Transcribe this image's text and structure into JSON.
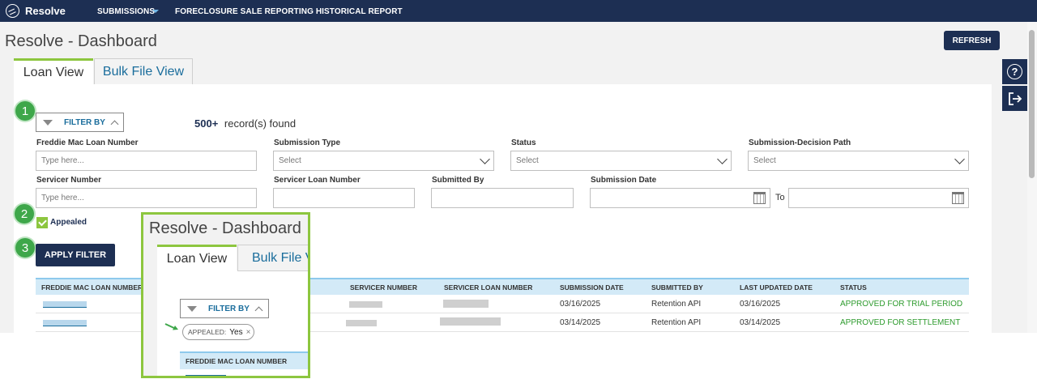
{
  "topbar": {
    "brand": "Resolve",
    "nav": [
      "SUBMISSIONS",
      "FORECLOSURE SALE REPORTING HISTORICAL REPORT"
    ]
  },
  "page": {
    "title": "Resolve - Dashboard",
    "refresh_label": "REFRESH"
  },
  "tabs": [
    "Loan View",
    "Bulk File View"
  ],
  "markers": [
    "1",
    "2",
    "3"
  ],
  "filter": {
    "toggle_label": "FILTER BY",
    "records_count": "500+",
    "records_label": "record(s) found",
    "fields": {
      "loan_number": {
        "label": "Freddie Mac Loan Number",
        "placeholder": "Type here..."
      },
      "submission_type": {
        "label": "Submission Type",
        "value": "Select"
      },
      "status": {
        "label": "Status",
        "value": "Select"
      },
      "decision_path": {
        "label": "Submission-Decision Path",
        "value": "Select"
      },
      "servicer_number": {
        "label": "Servicer Number",
        "placeholder": "Type here..."
      },
      "servicer_loan_number": {
        "label": "Servicer Loan Number"
      },
      "submitted_by": {
        "label": "Submitted By"
      },
      "submission_date": {
        "label": "Submission Date",
        "to_label": "To"
      }
    },
    "appealed_label": "Appealed",
    "appealed_checked": true,
    "apply_label": "APPLY FILTER"
  },
  "table": {
    "headers": [
      "FREDDIE MAC LOAN NUMBER",
      "SERVICER NUMBER",
      "SERVICER LOAN NUMBER",
      "SUBMISSION DATE",
      "SUBMITTED BY",
      "LAST UPDATED DATE",
      "STATUS"
    ],
    "rows": [
      {
        "submission_date": "03/16/2025",
        "submitted_by": "Retention API",
        "last_updated": "03/16/2025",
        "status": "APPROVED FOR TRIAL PERIOD"
      },
      {
        "submission_date": "03/14/2025",
        "submitted_by": "Retention API",
        "last_updated": "03/14/2025",
        "status": "APPROVED FOR SETTLEMENT"
      }
    ]
  },
  "inset": {
    "title": "Resolve - Dashboard",
    "tabs": [
      "Loan View",
      "Bulk File V"
    ],
    "filter_label": "FILTER BY",
    "chip_label": "APPEALED:",
    "chip_value": "Yes",
    "chip_close": "×",
    "column_header": "FREDDIE MAC LOAN NUMBER"
  },
  "colors": {
    "navy": "#1d2f53",
    "accent_green": "#8dc63f",
    "marker_green": "#3ea74a",
    "status_green": "#2e9b2e",
    "link_blue": "#1a6d9c"
  },
  "icons": [
    "logo-icon",
    "caret-down-icon",
    "help-icon",
    "logout-icon",
    "filter-icon",
    "chevron-up-icon",
    "chevron-down-icon",
    "calendar-icon",
    "check-icon",
    "close-icon",
    "arrow-icon"
  ]
}
